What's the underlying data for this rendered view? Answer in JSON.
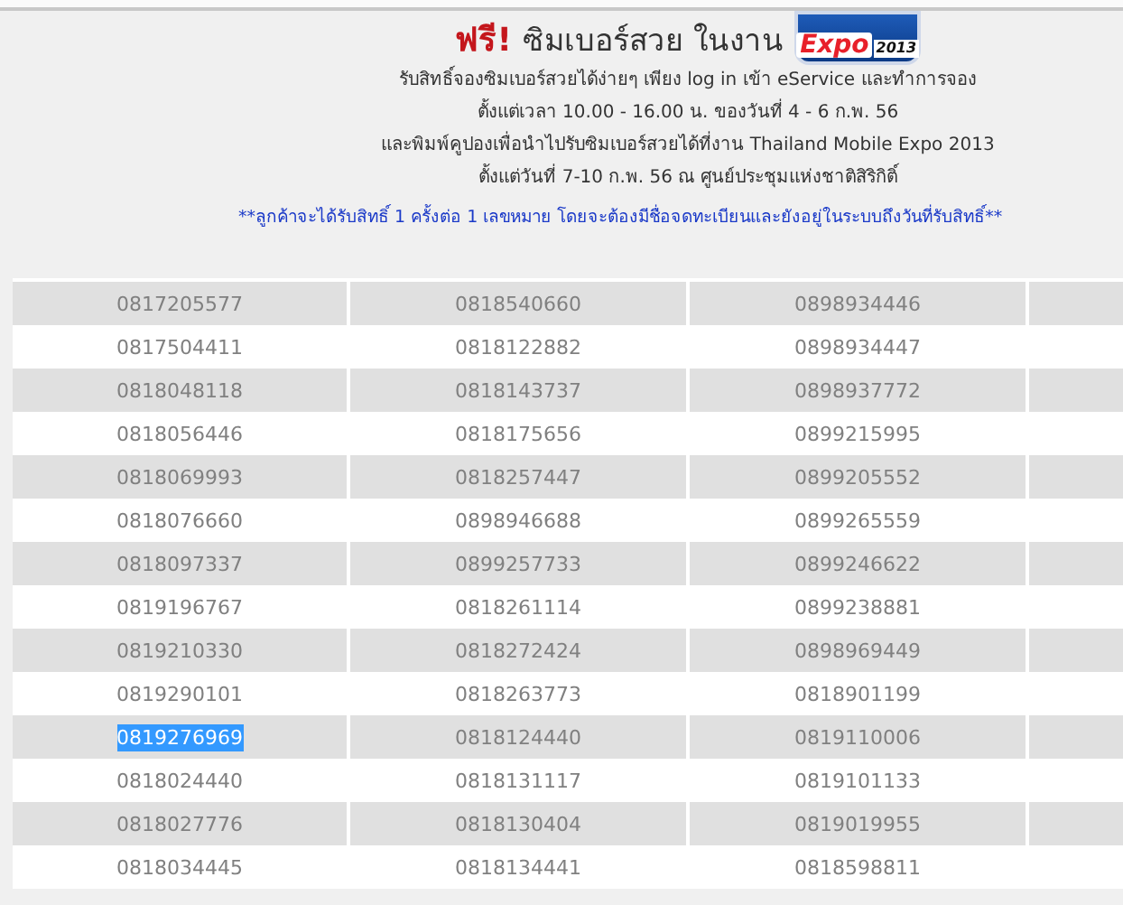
{
  "banner": {
    "free": "ฟรี!",
    "title": "ซิมเบอร์สวย ในงาน",
    "logo": {
      "main": "Expo",
      "year": "2013"
    },
    "lines": [
      "รับสิทธิ์จองซิมเบอร์สวยได้ง่ายๆ เพียง log in เข้า eService และทำการจอง",
      "ตั้งแต่เวลา 10.00 - 16.00 น. ของวันที่ 4 - 6 ก.พ. 56",
      "และพิมพ์คูปองเพื่อนำไปรับซิมเบอร์สวยได้ที่งาน  Thailand Mobile Expo 2013",
      "ตั้งแต่วันที่ 7-10 ก.พ. 56 ณ ศูนย์ประชุมแห่งชาติสิริกิติ์"
    ],
    "note": "**ลูกค้าจะได้รับสิทธิ์ 1 ครั้งต่อ 1 เลขหมาย โดยจะต้องมีชื่อจดทะเบียนและยังอยู่ในระบบถึงวันที่รับสิทธิ์**"
  },
  "table": {
    "rows": [
      [
        {
          "text": "0817205577",
          "selected": false
        },
        {
          "text": "0818540660",
          "selected": false
        },
        {
          "text": "0898934446",
          "selected": false
        }
      ],
      [
        {
          "text": "0817504411",
          "selected": false
        },
        {
          "text": "0818122882",
          "selected": false
        },
        {
          "text": "0898934447",
          "selected": false
        }
      ],
      [
        {
          "text": "0818048118",
          "selected": false
        },
        {
          "text": "0818143737",
          "selected": false
        },
        {
          "text": "0898937772",
          "selected": false
        }
      ],
      [
        {
          "text": "0818056446",
          "selected": false
        },
        {
          "text": "0818175656",
          "selected": false
        },
        {
          "text": "0899215995",
          "selected": false
        }
      ],
      [
        {
          "text": "0818069993",
          "selected": false
        },
        {
          "text": "0818257447",
          "selected": false
        },
        {
          "text": "0899205552",
          "selected": false
        }
      ],
      [
        {
          "text": "0818076660",
          "selected": false
        },
        {
          "text": "0898946688",
          "selected": false
        },
        {
          "text": "0899265559",
          "selected": false
        }
      ],
      [
        {
          "text": "0818097337",
          "selected": false
        },
        {
          "text": "0899257733",
          "selected": false
        },
        {
          "text": "0899246622",
          "selected": false
        }
      ],
      [
        {
          "text": "0819196767",
          "selected": false
        },
        {
          "text": "0818261114",
          "selected": false
        },
        {
          "text": "0899238881",
          "selected": false
        }
      ],
      [
        {
          "text": "0819210330",
          "selected": false
        },
        {
          "text": "0818272424",
          "selected": false
        },
        {
          "text": "0898969449",
          "selected": false
        }
      ],
      [
        {
          "text": "0819290101",
          "selected": false
        },
        {
          "text": "0818263773",
          "selected": false
        },
        {
          "text": "0818901199",
          "selected": false
        }
      ],
      [
        {
          "text": "0819276969",
          "selected": true
        },
        {
          "text": "0818124440",
          "selected": false
        },
        {
          "text": "0819110006",
          "selected": false
        }
      ],
      [
        {
          "text": "0818024440",
          "selected": false
        },
        {
          "text": "0818131117",
          "selected": false
        },
        {
          "text": "0819101133",
          "selected": false
        }
      ],
      [
        {
          "text": "0818027776",
          "selected": false
        },
        {
          "text": "0818130404",
          "selected": false
        },
        {
          "text": "0819019955",
          "selected": false
        }
      ],
      [
        {
          "text": "0818034445",
          "selected": false
        },
        {
          "text": "0818134441",
          "selected": false
        },
        {
          "text": "0818598811",
          "selected": false
        }
      ]
    ]
  }
}
